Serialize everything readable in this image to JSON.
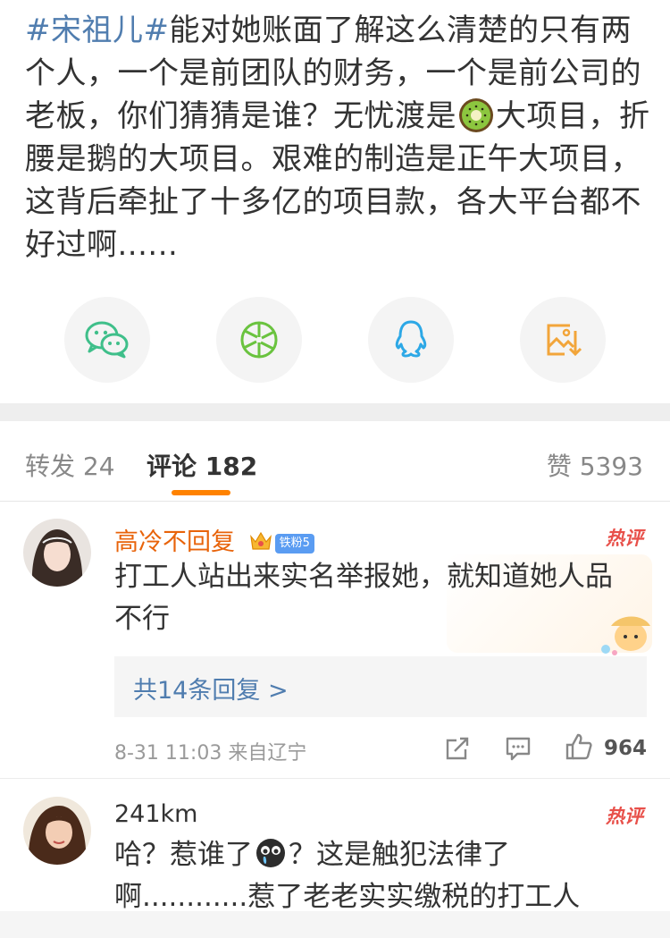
{
  "post": {
    "hashtag": "#宋祖儿#",
    "text_1": "能对她账面了解这么清楚的只有两个人，一个是前团队的财务，一个是前公司的老板，你们猜猜是谁？无忧渡是",
    "text_2": "大项目，折腰是鹅的大项目。艰难的制造是正午大项目，这背后牵扯了十多亿的项目款，各大平台都不好过啊......",
    "inline_emoji": "kiwi-emoji"
  },
  "share": {
    "items": [
      {
        "icon": "wechat-icon",
        "color": "#3fbf8a"
      },
      {
        "icon": "moments-icon",
        "color": "#6ac33f"
      },
      {
        "icon": "qq-icon",
        "color": "#2da8e6"
      },
      {
        "icon": "save-image-icon",
        "color": "#f2a53a"
      }
    ]
  },
  "tabs": {
    "repost_label": "转发",
    "repost_count": "24",
    "comments_label": "评论",
    "comments_count": "182",
    "likes_label": "赞",
    "likes_count": "5393",
    "accent_color": "#ff8200"
  },
  "comments": [
    {
      "author": "高冷不回复",
      "fan_badge": "铁粉5",
      "hot_label": "热评",
      "text": "打工人站出来实名举报她，就知道她人品不行",
      "replies_link": "共14条回复 >",
      "time": "8-31 11:03",
      "location": "来自辽宁",
      "likes": "964"
    },
    {
      "author": "241km",
      "hot_label": "热评",
      "text_1": "哈？惹谁了",
      "text_2": "？这是触犯法律了啊............惹了老老实实缴税的打工人"
    }
  ]
}
